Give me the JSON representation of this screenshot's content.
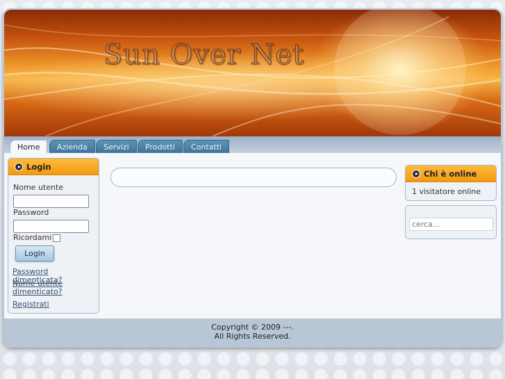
{
  "header": {
    "site_title": "Sun Over Net"
  },
  "nav": {
    "tabs": [
      {
        "label": "Home",
        "active": true
      },
      {
        "label": "Azienda",
        "active": false
      },
      {
        "label": "Servizi",
        "active": false
      },
      {
        "label": "Prodotti",
        "active": false
      },
      {
        "label": "Contatti",
        "active": false
      }
    ]
  },
  "login": {
    "title": "Login",
    "username_label": "Nome utente",
    "username_value": "",
    "password_label": "Password",
    "password_value": "",
    "remember_label": "Ricordami",
    "remember_checked": false,
    "submit_label": "Login",
    "links": [
      "Password dimenticata?",
      "Nome utente dimenticato?",
      "Registrati"
    ]
  },
  "online": {
    "title": "Chi è online",
    "text": "1 visitatore online"
  },
  "search": {
    "placeholder": "cerca..."
  },
  "footer": {
    "copyright": "Copyright © 2009 ---.",
    "rights": "All Rights Reserved."
  },
  "colors": {
    "accent_orange": "#f39a12",
    "tab_blue": "#4a7fa4",
    "link": "#35506d"
  },
  "icons": [
    "bullet-arrow-icon"
  ]
}
